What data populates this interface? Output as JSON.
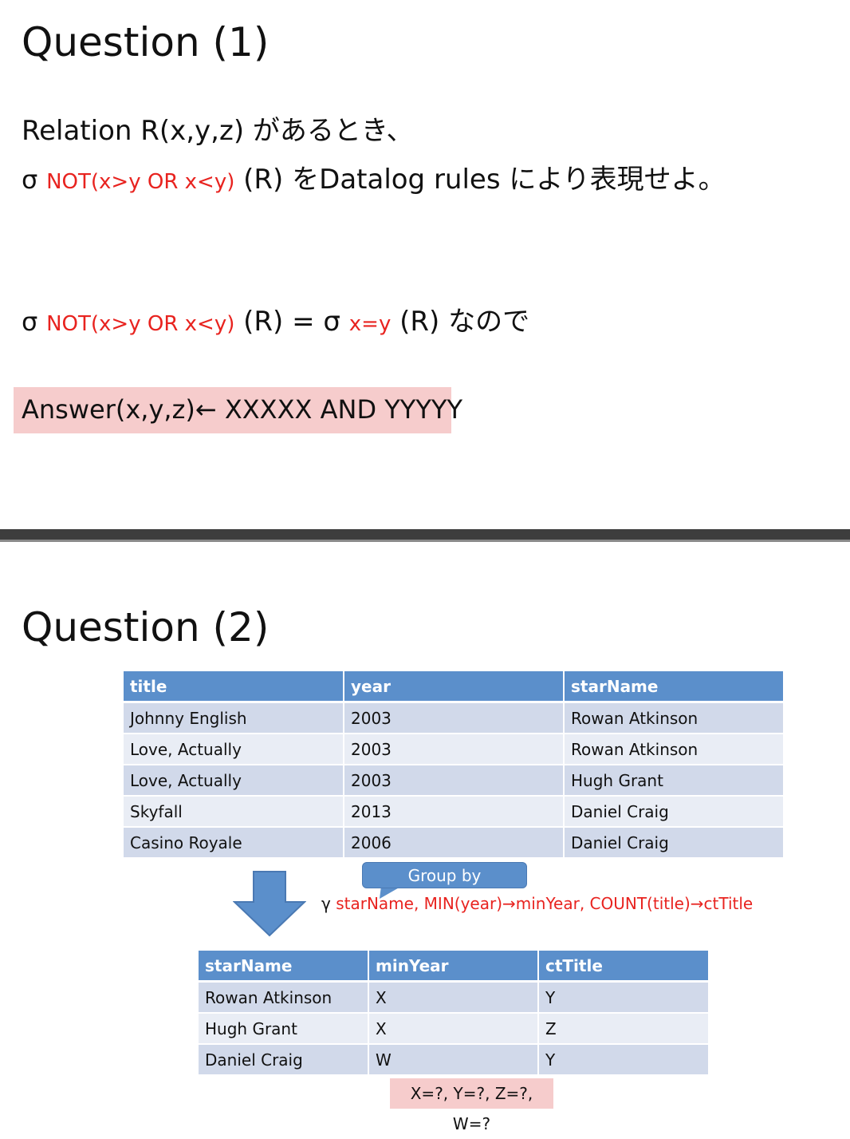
{
  "question1": {
    "title": "Question (1)",
    "line1": "Relation R(x,y,z) があるとき、",
    "line2": {
      "sigma": "σ",
      "condition": "NOT(x>y OR x<y)",
      "rest": "(R) をDatalog rules により表現せよ。"
    },
    "line3": {
      "sigma": "σ",
      "condition": "NOT(x>y OR x<y)",
      "middle": "(R) = σ",
      "condition2": "x=y",
      "rest": "(R) なので"
    },
    "answer": "Answer(x,y,z)← XXXXX AND YYYYY"
  },
  "question2": {
    "title": "Question (2)",
    "movies_table": {
      "headers": [
        "title",
        "year",
        "starName"
      ],
      "rows": [
        [
          "Johnny English",
          "2003",
          "Rowan Atkinson"
        ],
        [
          "Love, Actually",
          "2003",
          "Rowan Atkinson"
        ],
        [
          "Love, Actually",
          "2003",
          "Hugh Grant"
        ],
        [
          "Skyfall",
          "2013",
          "Daniel Craig"
        ],
        [
          "Casino Royale",
          "2006",
          "Daniel Craig"
        ]
      ]
    },
    "callout": "Group by",
    "gamma": {
      "symbol": "γ",
      "expression": "starName, MIN(year)→minYear, COUNT(title)→ctTitle"
    },
    "result_table": {
      "headers": [
        "starName",
        "minYear",
        "ctTitle"
      ],
      "rows": [
        [
          "Rowan Atkinson",
          "X",
          "Y"
        ],
        [
          "Hugh Grant",
          "X",
          "Z"
        ],
        [
          "Daniel Craig",
          "W",
          "Y"
        ]
      ]
    },
    "question": "X=?, Y=?, Z=?, W=?"
  },
  "colors": {
    "accent_red": "#e8231f",
    "table_header": "#5b8fcb",
    "row_dark": "#d1d9ea",
    "row_light": "#e9edf5",
    "highlight_pink": "#f6cccc",
    "divider": "#3d3d3d"
  },
  "icons": {
    "arrow": "down-arrow-icon"
  }
}
